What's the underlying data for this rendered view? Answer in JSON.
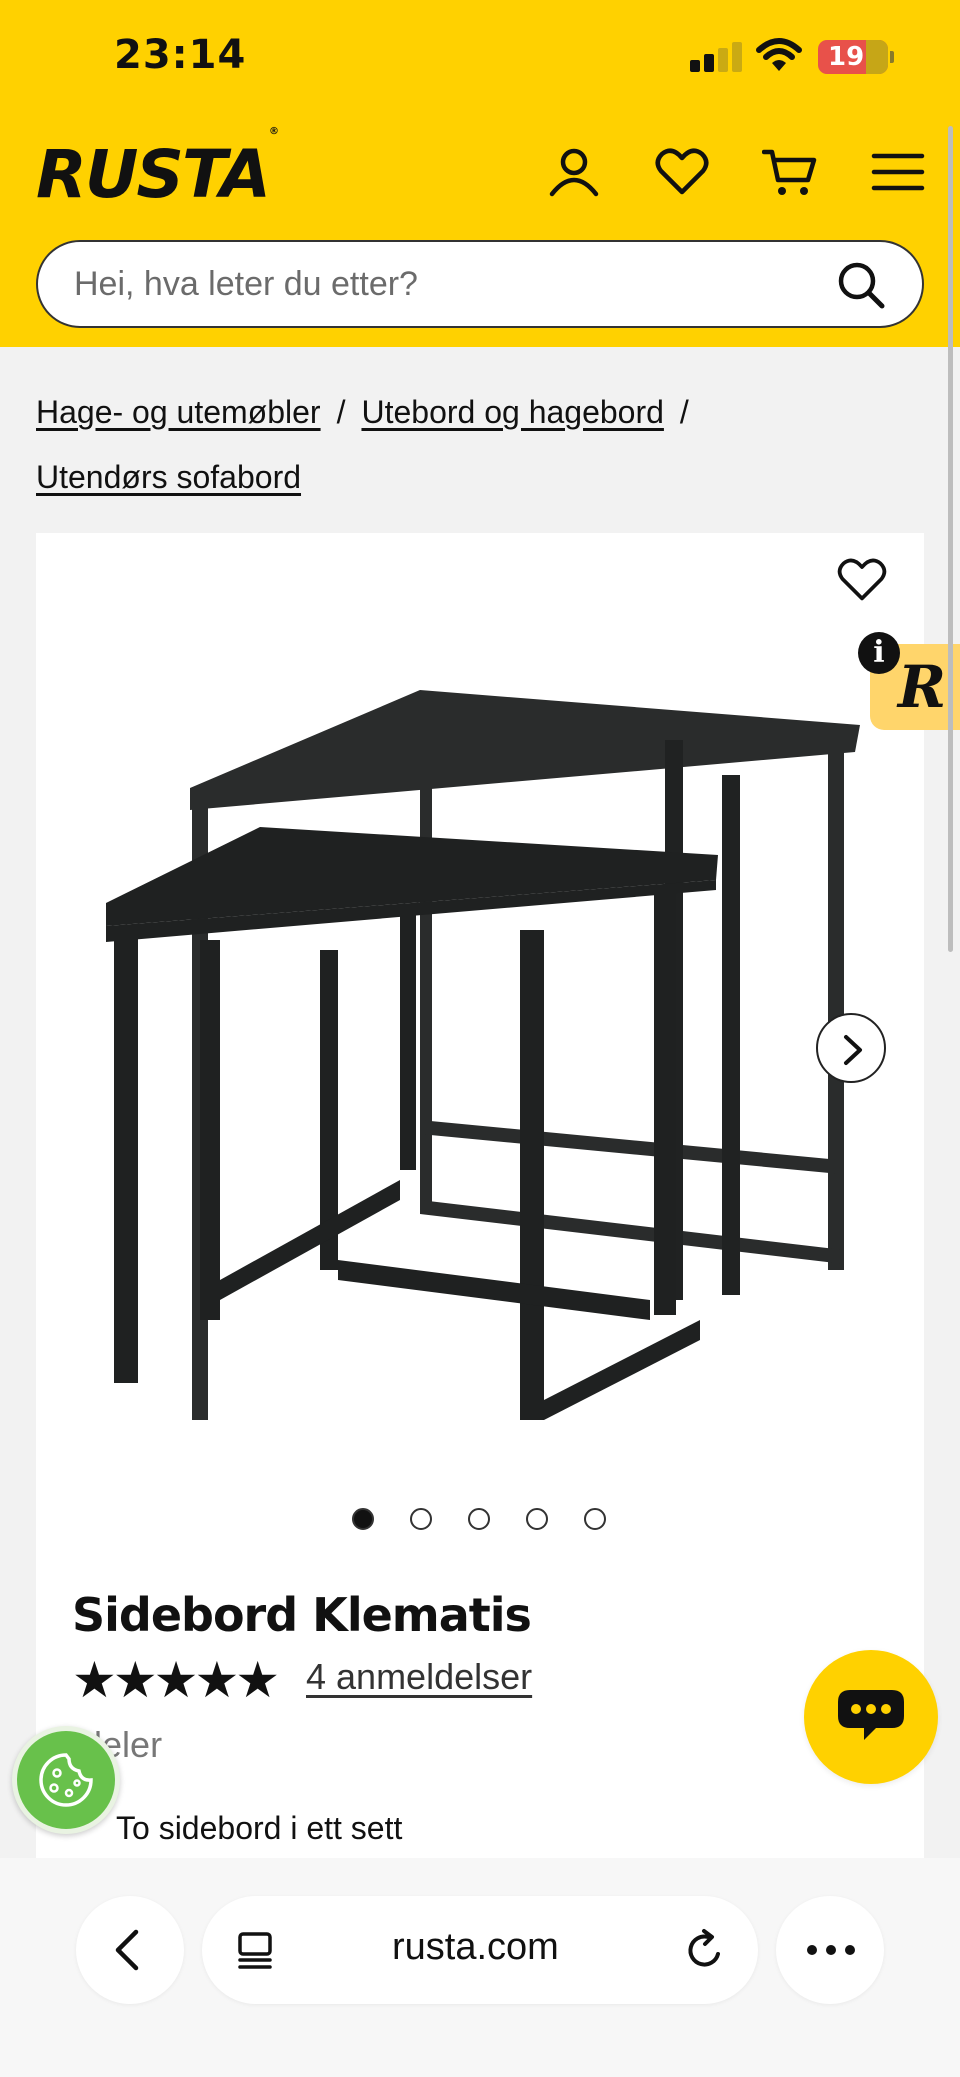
{
  "status_bar": {
    "time": "23:14",
    "battery": "19"
  },
  "header": {
    "logo": "RUSTA",
    "search_placeholder": "Hei, hva leter du etter?"
  },
  "icons": [
    "account-icon",
    "heart-icon",
    "cart-icon",
    "menu-icon",
    "search-icon"
  ],
  "breadcrumb": {
    "items": [
      "Hage- og utemøbler",
      "Utebord og hagebord",
      "Utendørs sofabord"
    ],
    "separator": "/"
  },
  "product": {
    "title": "Sidebord Klematis",
    "rating_stars": "★★★★★",
    "rating": 5,
    "reviews_label": "4 anmeldelser",
    "desc_partial": "deler",
    "bullets": [
      "To sidebord i ett sett"
    ],
    "gallery_count": 5,
    "gallery_active": 0
  },
  "badges": {
    "info": "i",
    "r": "R"
  },
  "browser": {
    "url": "rusta.com"
  },
  "colors": {
    "brand_yellow": "#ffd100",
    "cookie_green": "#68c14b"
  }
}
